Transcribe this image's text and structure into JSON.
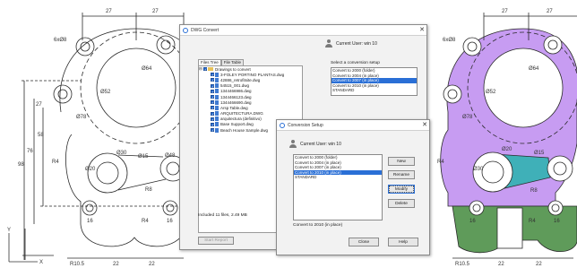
{
  "drawing_left": {
    "dims": [
      "27",
      "27",
      "6xØ8",
      "Ø64",
      "Ø52",
      "Ø78",
      "27",
      "58",
      "76",
      "98",
      "R4",
      "Ø20",
      "Ø15",
      "R8",
      "Ø30",
      "Ø48",
      "16",
      "R4",
      "16",
      "R10.5",
      "22",
      "22"
    ]
  },
  "drawing_right": {
    "dims": [
      "27",
      "27",
      "6xØ8",
      "Ø64",
      "Ø52",
      "Ø78",
      "Ø20",
      "Ø15",
      "R4",
      "Ø30",
      "R8",
      "16",
      "R4",
      "16",
      "R10.5",
      "22",
      "22"
    ]
  },
  "dwg_convert": {
    "title": "DWG Convert",
    "user_label": "Current User: win 10",
    "tabs": [
      "Files Tree",
      "File Table"
    ],
    "tree_root": "Drawings to convert",
    "files": [
      "3-FOLEY PORTINO PLANTAS.dwg",
      "42886_retrofitsite.dwg",
      "54515_001.dwg",
      "1344466986.dwg",
      "1344466123.dwg",
      "1344466690.dwg",
      "Arsp Table.dwg",
      "ARQUITECTURA.DWG",
      "arquitectura (definitivo)",
      "Base Support.dwg",
      "Beach House Sample.dwg"
    ],
    "setup_group_label": "Select a conversion setup",
    "setups": [
      "Convert to 2000 (folder)",
      "Convert to 2004 (in place)",
      "Convert to 2007 (in place)",
      "Convert to 2010 (in place)",
      "STANDARD"
    ],
    "selected_setup": 2,
    "status": "Included 11 files, 2.49 MB",
    "start_report_label": "Start Report"
  },
  "conversion_setup": {
    "title": "Conversion Setup",
    "user_label": "Current User: win 10",
    "setups": [
      "Convert to 2000 (folder)",
      "Convert to 2004 (in place)",
      "Convert to 2007 (in place)",
      "Convert to 2010 (in place)",
      "STANDARD"
    ],
    "selected_setup": 3,
    "buttons": {
      "new": "New",
      "rename": "Rename",
      "modify": "Modify",
      "delete": "Delete",
      "close": "Close",
      "help": "Help"
    },
    "description": "Convert to 2010 (in place)"
  },
  "colors": {
    "purple_fill": "#c79cf2",
    "green_fill": "#5f9b5a",
    "teal_fill": "#3fb0b8",
    "selection": "#2a6fd6"
  }
}
